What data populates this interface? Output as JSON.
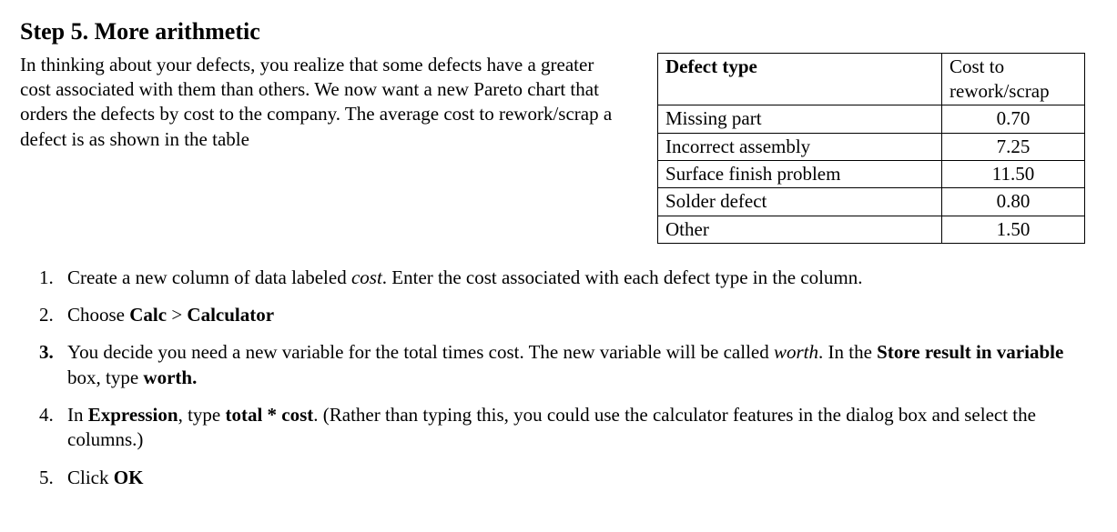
{
  "heading": "Step 5.  More arithmetic",
  "intro": "In thinking about your defects, you realize that some defects have a greater cost associated with them than others.  We now want a new Pareto chart that orders the defects by cost to the company.  The average cost to rework/scrap a defect is as shown in the table",
  "table": {
    "header": {
      "col1": "Defect type",
      "col2": "Cost to rework/scrap"
    },
    "rows": [
      {
        "defect": "Missing part",
        "cost": "0.70"
      },
      {
        "defect": "Incorrect assembly",
        "cost": "7.25"
      },
      {
        "defect": "Surface finish problem",
        "cost": "11.50"
      },
      {
        "defect": "Solder defect",
        "cost": "0.80"
      },
      {
        "defect": "Other",
        "cost": "1.50"
      }
    ]
  },
  "steps": {
    "s1": {
      "pre": "Create a new column of data labeled ",
      "em": "cost",
      "post": ".   Enter the cost associated with each defect type in the column."
    },
    "s2": {
      "pre": "Choose ",
      "b1": "Calc",
      "mid": " > ",
      "b2": "Calculator"
    },
    "s3": {
      "pre": "You decide you need a new variable for the total times cost.  The new variable will be called ",
      "em": "worth",
      "mid": ".  In the ",
      "b1": "Store result in variable",
      "mid2": " box, type ",
      "b2": "worth."
    },
    "s4": {
      "pre": "In ",
      "b1": "Expression",
      "mid": ", type ",
      "b2": "total * cost",
      "post": ".  (Rather than typing this, you could use the calculator features in the dialog box and select the columns.)"
    },
    "s5": {
      "pre": "Click ",
      "b1": "OK"
    }
  }
}
